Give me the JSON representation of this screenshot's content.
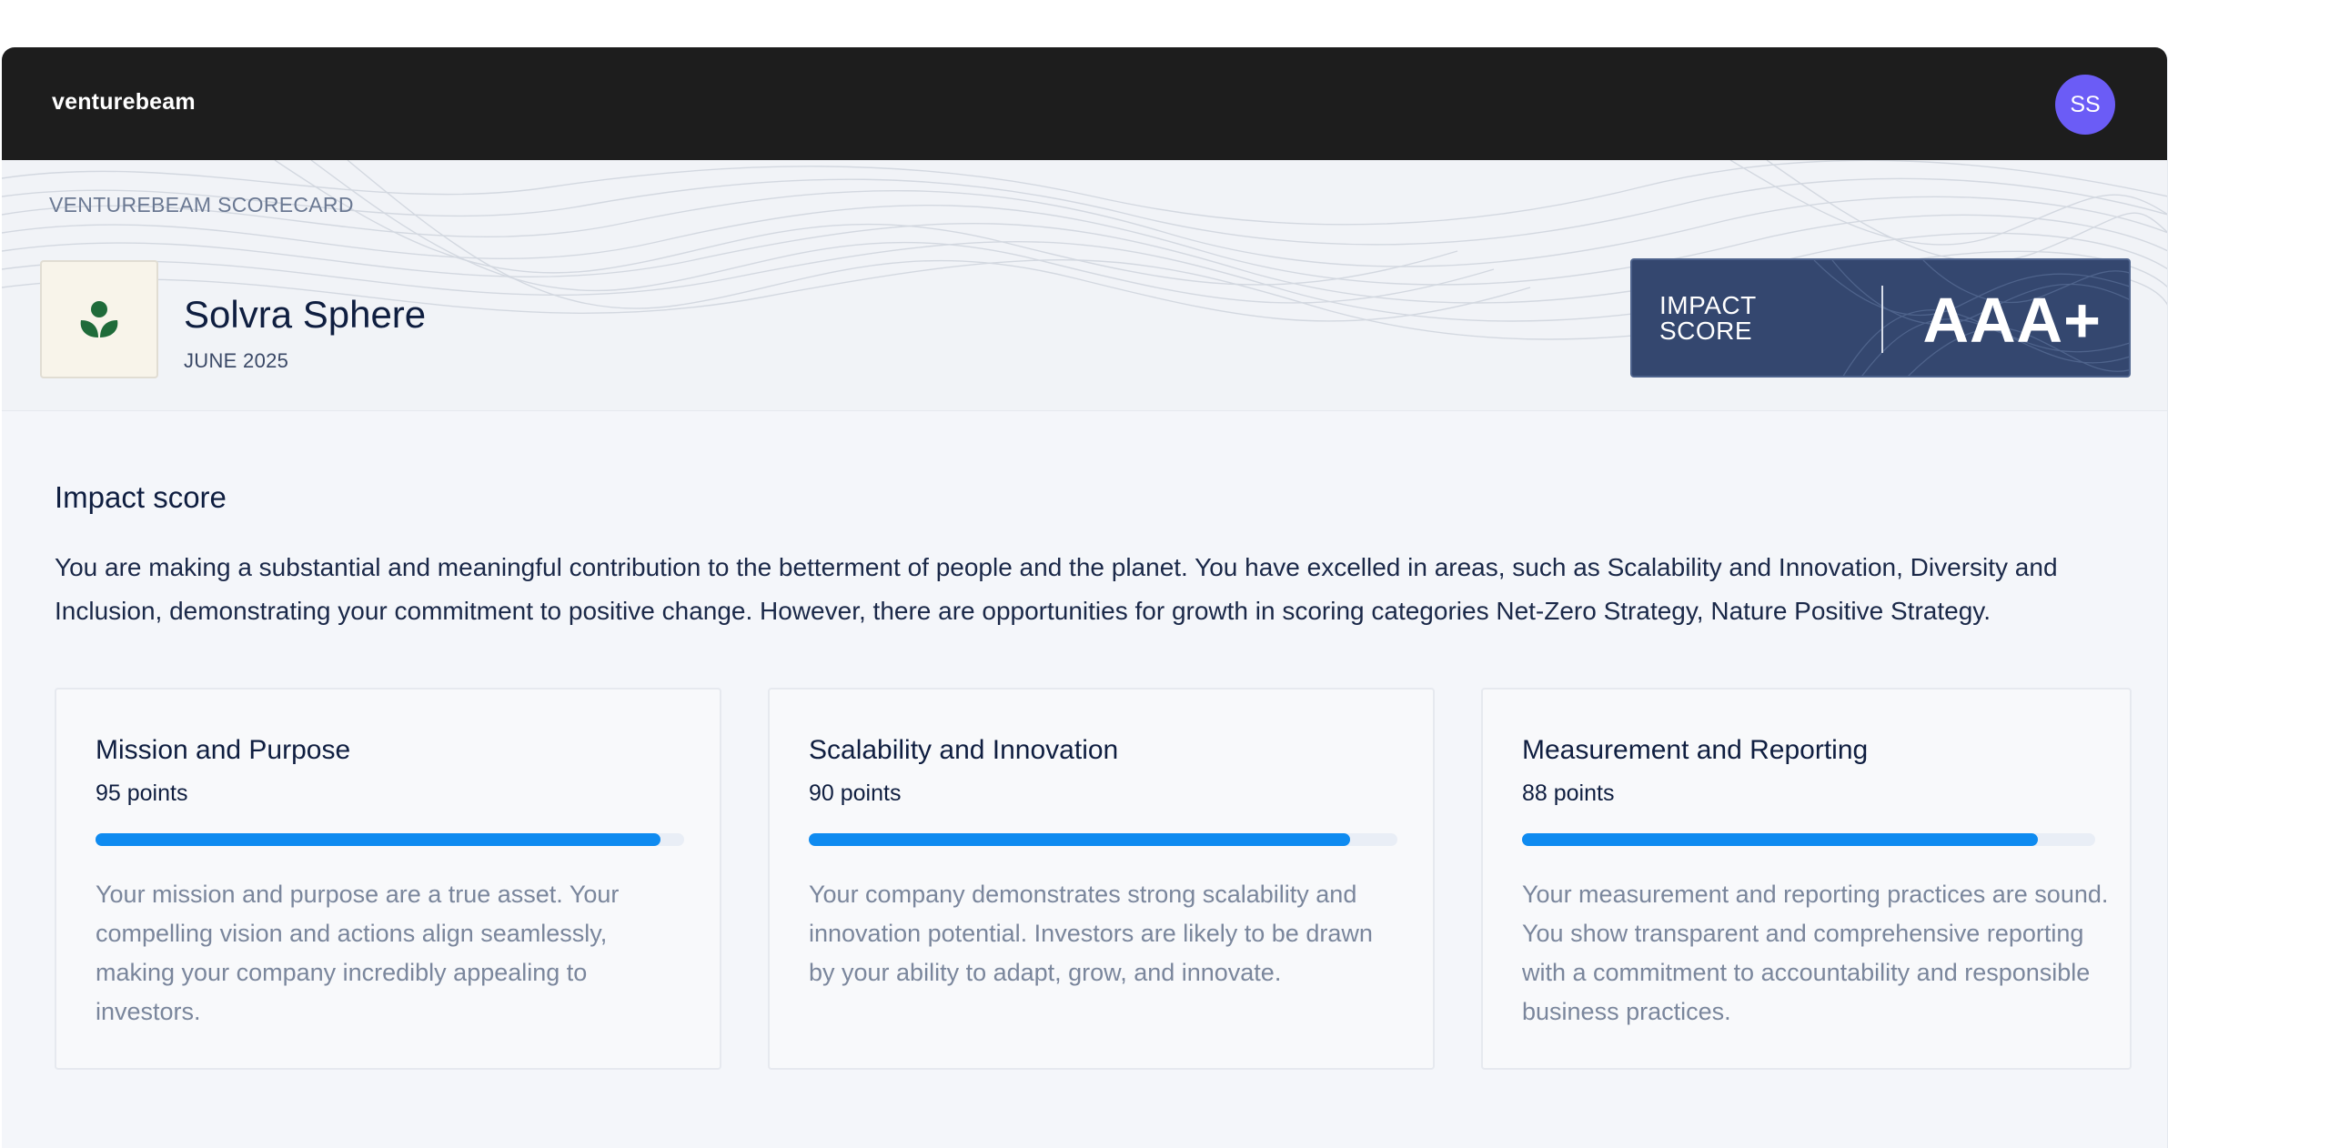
{
  "header": {
    "logo_text": "venturebeam",
    "avatar_initials": "SS",
    "avatar_color": "#6b5cf6"
  },
  "hero": {
    "eyebrow": "VENTUREBEAM SCORECARD",
    "company_logo_icon": "sprout-icon",
    "company_name": "Solvra Sphere",
    "date": "JUNE 2025",
    "impact_score": {
      "label_line1": "IMPACT",
      "label_line2": "SCORE",
      "value": "AAA+"
    }
  },
  "main": {
    "section_title": "Impact score",
    "summary": "You are making a substantial and meaningful contribution to the betterment of people and the planet. You have excelled in areas, such as Scalability and Innovation, Diversity and Inclusion, demonstrating your commitment to positive change. However, there are opportunities for growth in scoring categories Net-Zero Strategy, Nature Positive Strategy.",
    "cards": [
      {
        "title": "Mission and Purpose",
        "points_label": "95 points",
        "progress": 0.96,
        "body": "Your mission and purpose are a true asset. Your compelling vision and actions align seamlessly, making your company incredibly appealing to investors."
      },
      {
        "title": "Scalability and Innovation",
        "points_label": "90 points",
        "progress": 0.92,
        "body": "Your company demonstrates strong scalability and innovation potential. Investors are likely to be drawn by your ability to adapt, grow, and innovate."
      },
      {
        "title": "Measurement and Reporting",
        "points_label": "88 points",
        "progress": 0.9,
        "body": "Your measurement and reporting practices are sound. You show transparent and comprehensive reporting with a commitment to accountability and responsible business practices."
      }
    ]
  },
  "colors": {
    "topbar": "#1d1d1d",
    "score_box": "#34476f",
    "progress_fill": "#0f8bf0",
    "logo_green": "#1f6b3a"
  }
}
